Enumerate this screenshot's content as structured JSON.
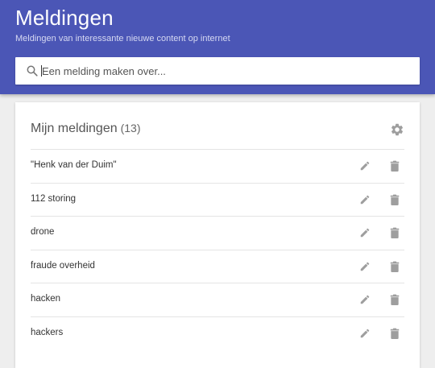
{
  "header": {
    "title": "Meldingen",
    "subtitle": "Meldingen van interessante nieuwe content op internet",
    "search": {
      "placeholder": "Een melding maken over...",
      "value": "",
      "icon": "search-icon"
    }
  },
  "alerts_card": {
    "title": "Mijn meldingen",
    "count": "(13)",
    "settings_icon": "gear-icon",
    "items": [
      {
        "label": "\"Henk van der Duim\""
      },
      {
        "label": "112 storing"
      },
      {
        "label": "drone"
      },
      {
        "label": "fraude overheid"
      },
      {
        "label": "hacken"
      },
      {
        "label": "hackers"
      }
    ],
    "item_actions": [
      "pencil-icon",
      "trash-icon"
    ]
  },
  "colors": {
    "header_bg": "#4b56b6",
    "page_bg": "#eeeeee",
    "icon_gray": "#9e9e9e"
  }
}
